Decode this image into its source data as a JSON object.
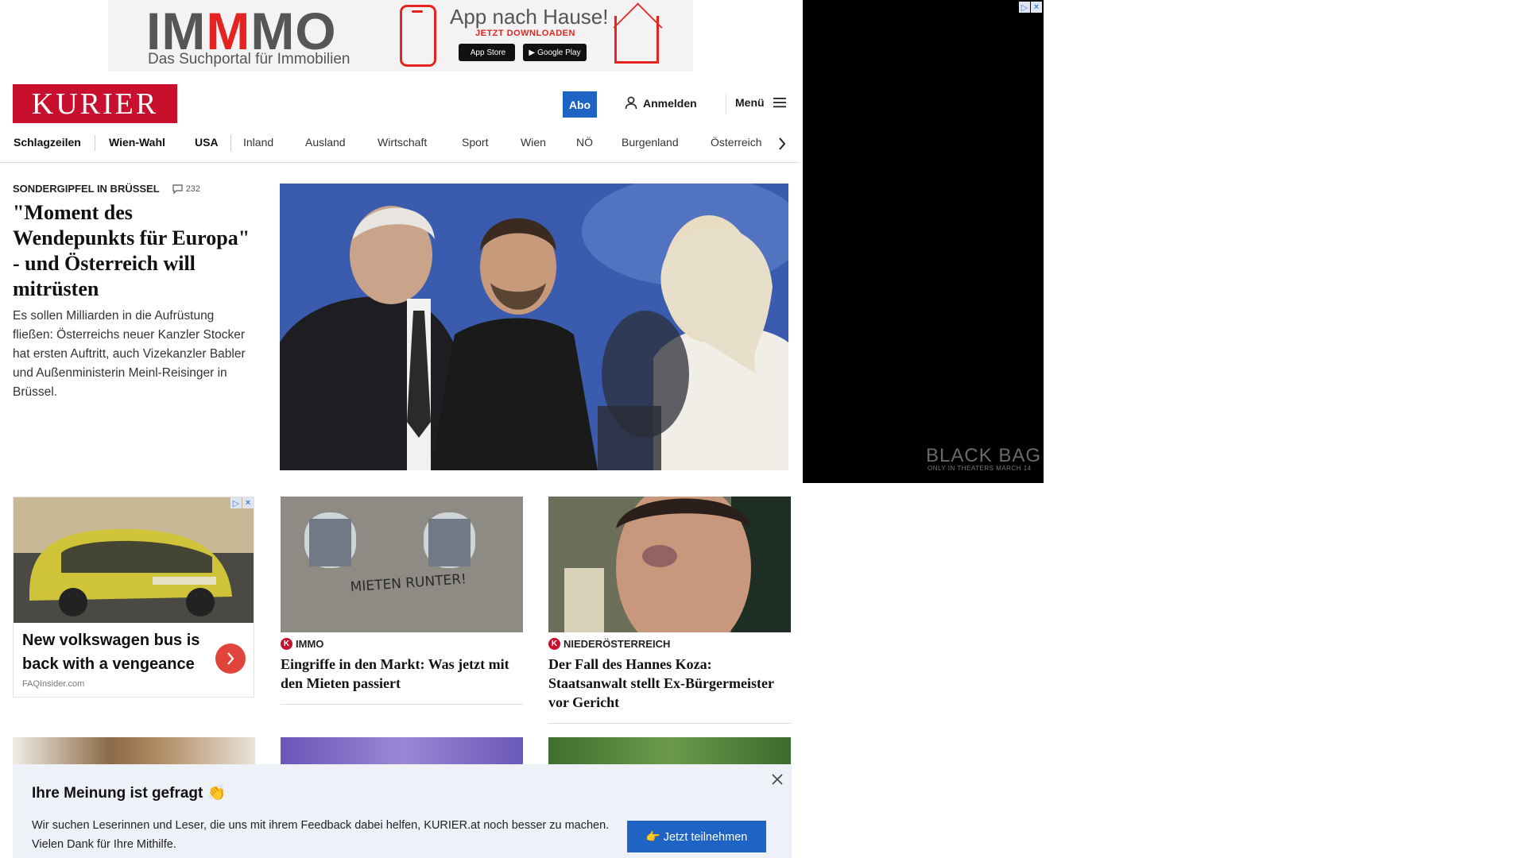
{
  "top_ad": {
    "logo_prefix": "IM",
    "logo_red": "M",
    "logo_suffix": "MO",
    "logo_sub": "Das Suchportal für Immobilien",
    "app_title": "App nach Hause!",
    "app_cta": "JETZT DOWNLOADEN",
    "apple_badge": "App Store",
    "google_badge": "Google Play"
  },
  "header": {
    "logo": "KURIER",
    "abo_label": "Abo",
    "login_label": "Anmelden",
    "menu_label": "Menü"
  },
  "nav": {
    "items": [
      "Schlagzeilen",
      "Wien-Wahl",
      "USA",
      "Inland",
      "Ausland",
      "Wirtschaft",
      "Sport",
      "Wien",
      "NÖ",
      "Burgenland",
      "Österreich"
    ]
  },
  "lead": {
    "kicker": "SONDERGIPFEL IN BRÜSSEL",
    "comment_count": "232",
    "title": "\"Moment des Wendepunkts für Europa\" - und Österreich will mitrüsten",
    "teaser": "Es sollen Milliarden in die Aufrüstung fließen: Österreichs neuer Kanzler Stocker hat ersten Auftritt, auch Vizekanzler Babler und Außenministerin Meinl-Reisinger in Brüssel."
  },
  "side_ad": {
    "brand": "BLACK BAG",
    "tagline": "ONLY IN THEATERS MARCH 14"
  },
  "ad_card": {
    "title": "New volkswagen bus is back with a vengeance",
    "source": "FAQInsider.com"
  },
  "teasers": [
    {
      "kicker": "IMMO",
      "title": "Eingriffe in den Markt: Was jetzt mit den Mieten passiert",
      "image_text": "MIETEN RUNTER!"
    },
    {
      "kicker": "NIEDERÖSTERREICH",
      "title": "Der Fall des Hannes Koza: Staatsanwalt stellt Ex-Bürgermeister vor Gericht"
    }
  ],
  "feedback": {
    "title": "Ihre Meinung ist gefragt 👏",
    "text": "Wir suchen Leserinnen und Leser, die uns mit ihrem Feedback dabei helfen, KURIER.at noch besser zu machen. Vielen Dank für Ihre Mithilfe.",
    "button": "👉 Jetzt teilnehmen"
  },
  "colors": {
    "brand_red": "#c8102e",
    "accent_blue": "#1f63c4",
    "feedback_bg": "#eef1f8"
  }
}
